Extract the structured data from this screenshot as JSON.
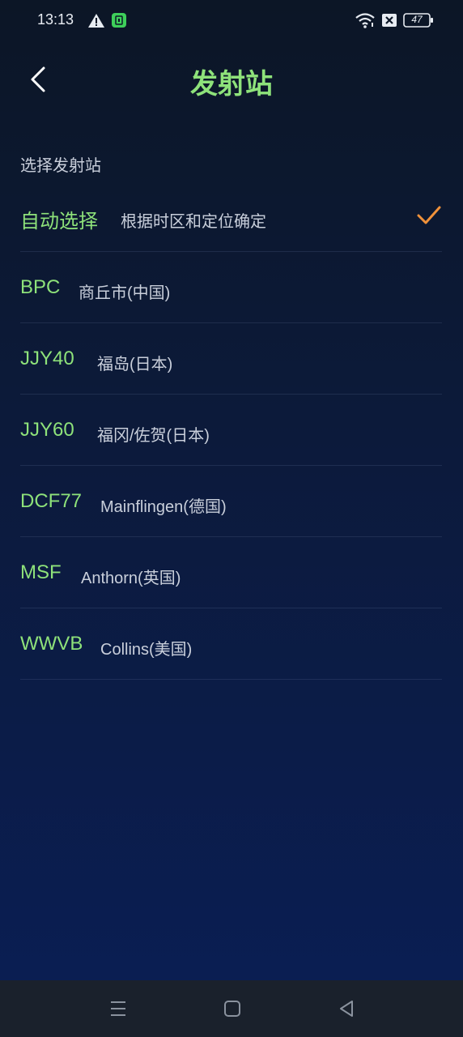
{
  "status_bar": {
    "time": "13:13",
    "battery": "47",
    "icons": [
      "warning-icon",
      "app-notification-icon",
      "wifi-icon",
      "sim-off-icon",
      "battery-icon"
    ]
  },
  "header": {
    "title": "发射站",
    "back_icon": "chevron-left-icon"
  },
  "section_label": "选择发射站",
  "stations": [
    {
      "code": "自动选择",
      "desc": "根据时区和定位确定",
      "selected": true
    },
    {
      "code": "BPC",
      "desc": "商丘市(中国)",
      "selected": false
    },
    {
      "code": "JJY40",
      "desc": "福岛(日本)",
      "selected": false
    },
    {
      "code": "JJY60",
      "desc": "福冈/佐贺(日本)",
      "selected": false
    },
    {
      "code": "DCF77",
      "desc": "Mainflingen(德国)",
      "selected": false
    },
    {
      "code": "MSF",
      "desc": "Anthorn(英国)",
      "selected": false
    },
    {
      "code": "WWVB",
      "desc": "Collins(美国)",
      "selected": false
    }
  ],
  "nav_bar": {
    "icons": [
      "menu-icon",
      "home-icon",
      "back-triangle-icon"
    ]
  },
  "colors": {
    "accent_green": "#8ee27a",
    "check_orange": "#f0913a",
    "background_top": "#0c1626",
    "background_bottom": "#0a1e55",
    "nav_bar": "#1a212c"
  }
}
